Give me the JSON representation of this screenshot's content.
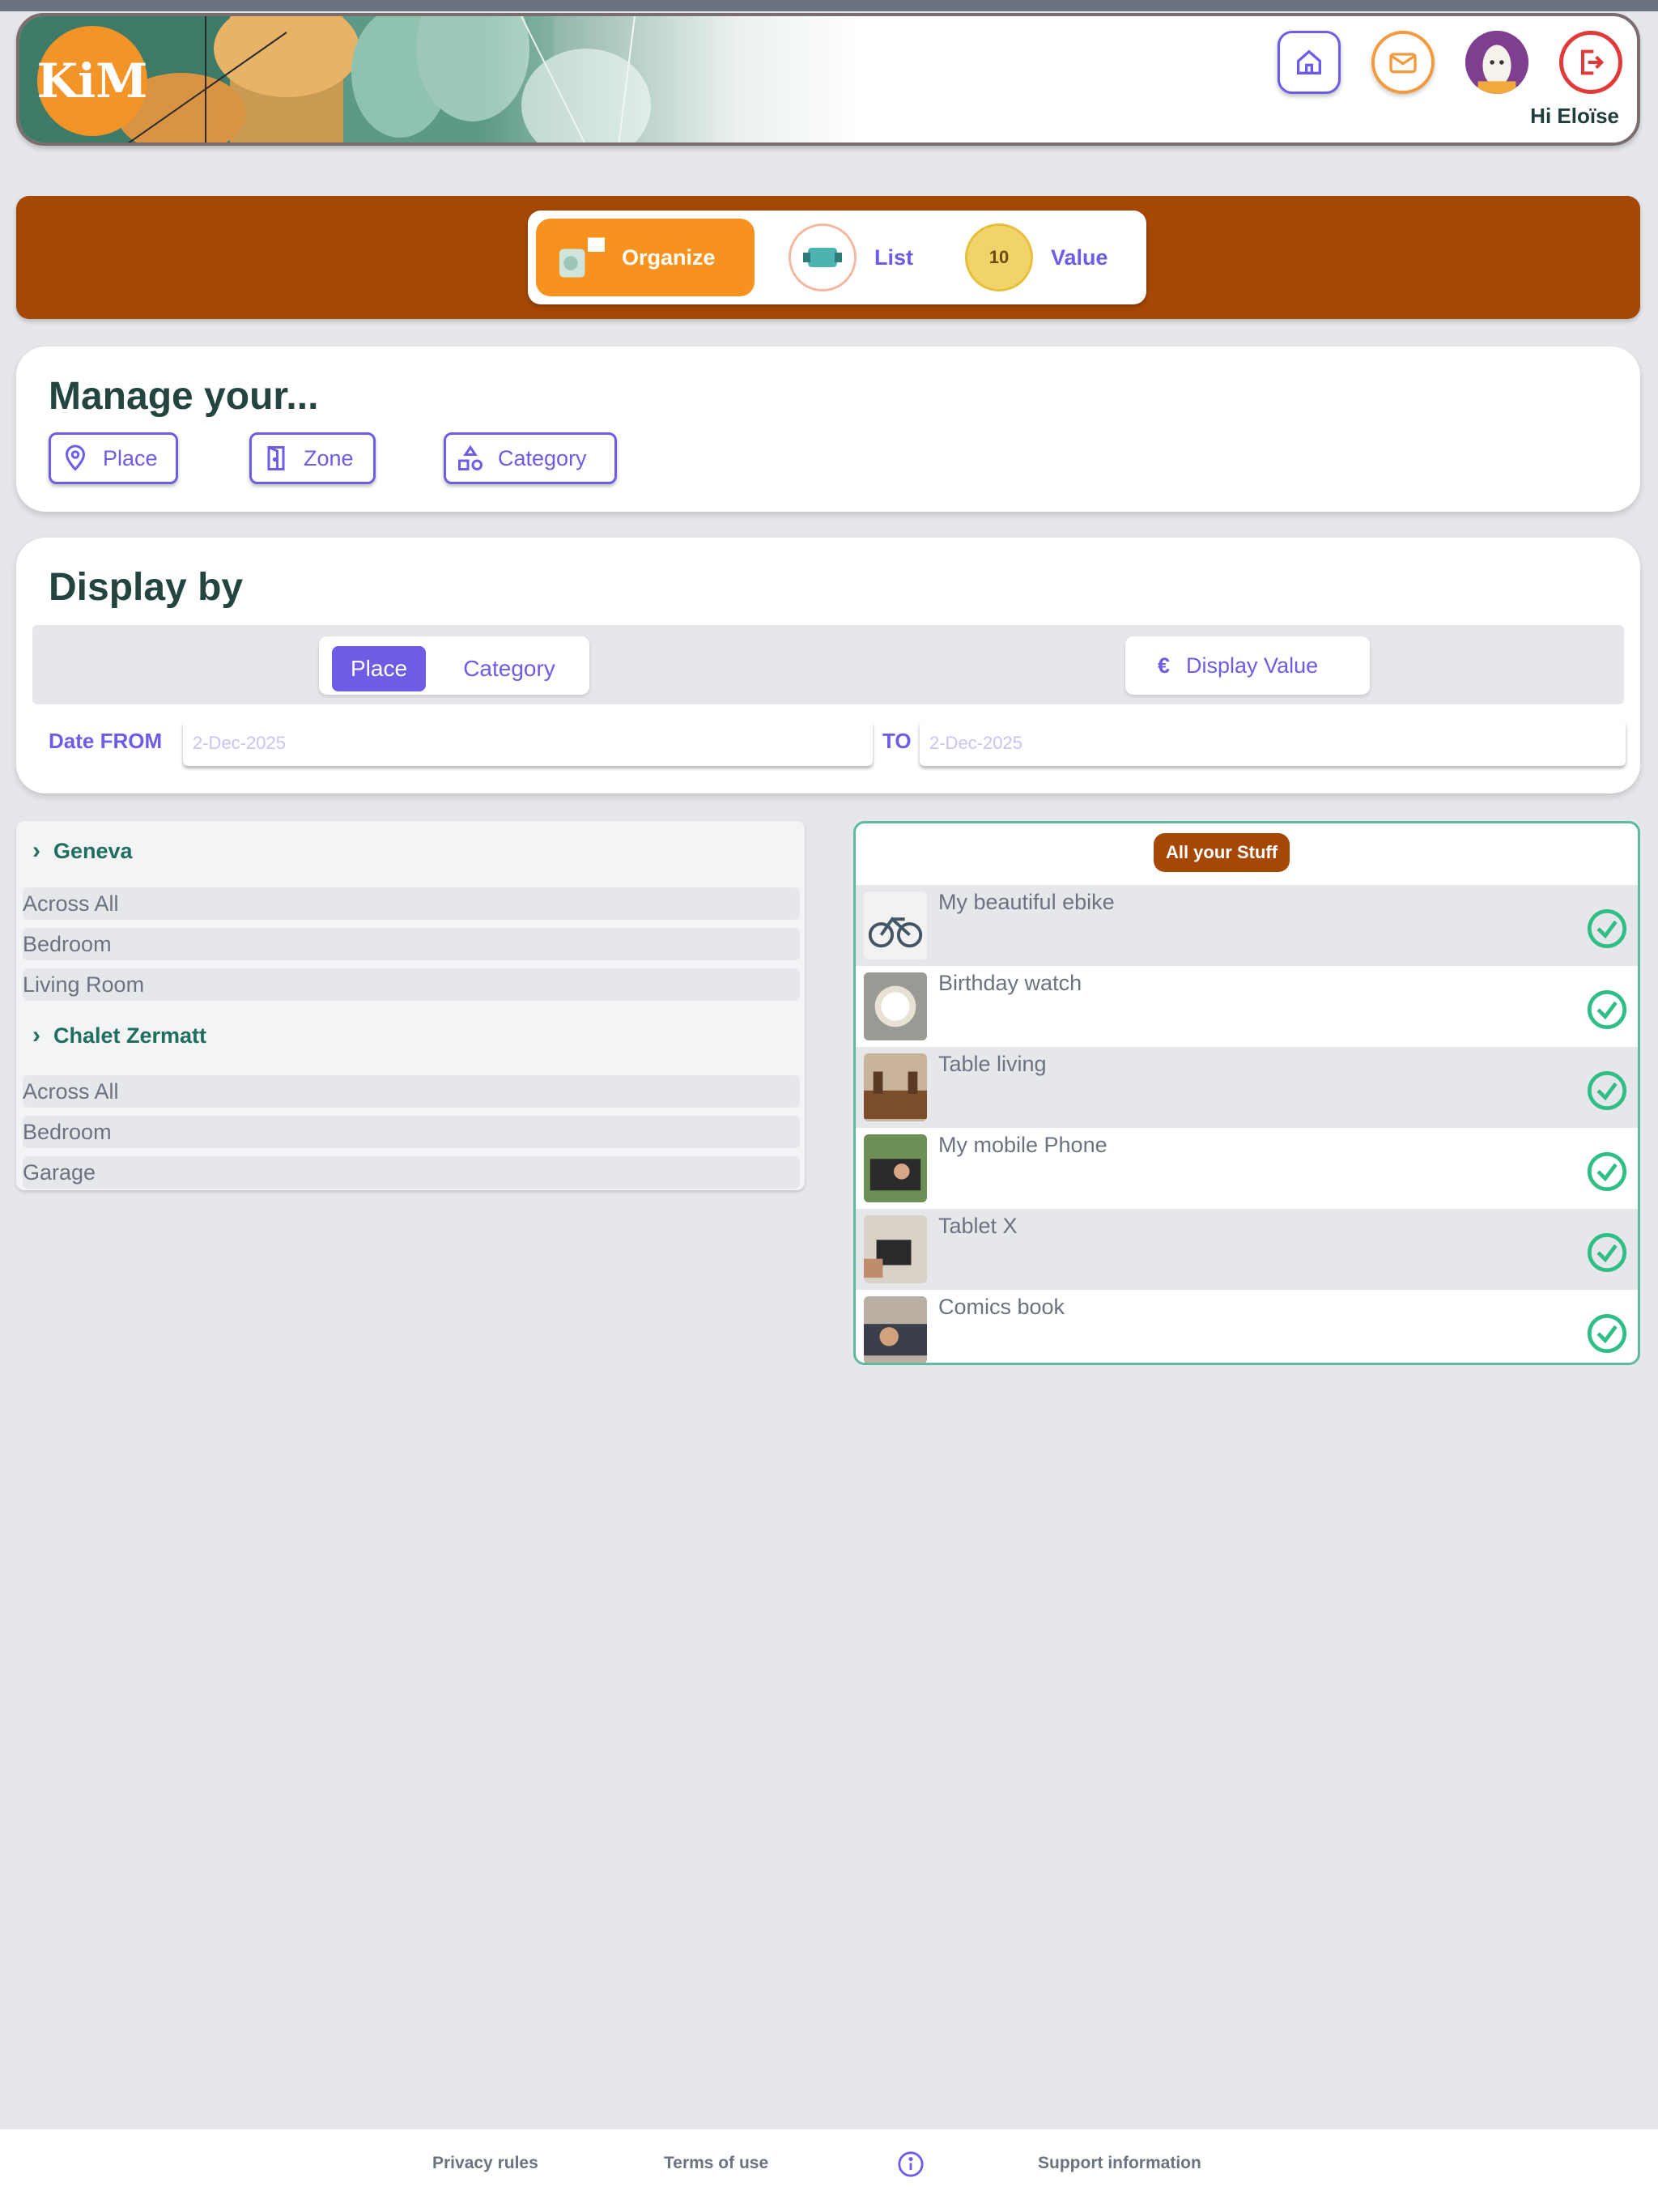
{
  "header": {
    "logo_text": "KiM",
    "greeting": "Hi Eloïse",
    "icons": [
      "home-icon",
      "mail-icon",
      "avatar",
      "logout-icon"
    ]
  },
  "nav": {
    "organize": "Organize",
    "list": "List",
    "value": "Value",
    "value_badge": "10"
  },
  "manage": {
    "title": "Manage your...",
    "buttons": [
      {
        "label": "Place",
        "icon": "map-pin-icon"
      },
      {
        "label": "Zone",
        "icon": "door-icon"
      },
      {
        "label": "Category",
        "icon": "shapes-icon"
      }
    ]
  },
  "display": {
    "title": "Display by",
    "toggle": [
      "Place",
      "Category"
    ],
    "selected": "Place",
    "display_value": "Display Value",
    "currency": "€",
    "date_from_label": "Date FROM",
    "date_from": "2-Dec-2025",
    "to_label": "TO",
    "date_to": "2-Dec-2025"
  },
  "tree": {
    "groups": [
      {
        "name": "Geneva",
        "items": [
          "Across All",
          "Bedroom",
          "Living Room"
        ]
      },
      {
        "name": "Chalet Zermatt",
        "items": [
          "Across All",
          "Bedroom",
          "Garage"
        ]
      }
    ]
  },
  "items": {
    "badge": "All your Stuff",
    "list": [
      {
        "name": "My beautiful ebike"
      },
      {
        "name": "Birthday watch"
      },
      {
        "name": "Table living"
      },
      {
        "name": "My mobile Phone"
      },
      {
        "name": "Tablet X"
      },
      {
        "name": "Comics book"
      }
    ]
  },
  "footer": {
    "privacy": "Privacy rules",
    "terms": "Terms of use",
    "support": "Support information"
  },
  "colors": {
    "brand_orange": "#f7921e",
    "nav_brown": "#a54705",
    "accent_purple": "#6d5ce6",
    "teal": "#5fb8a0"
  }
}
